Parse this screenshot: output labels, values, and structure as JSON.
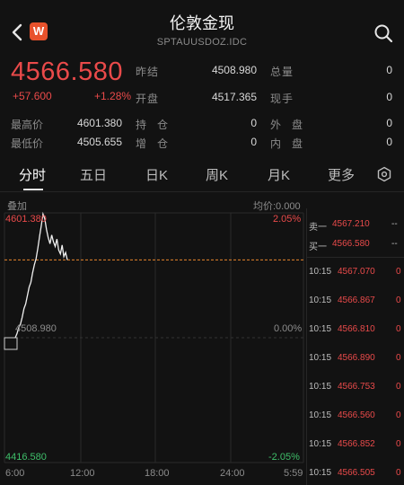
{
  "header": {
    "title": "伦敦金现",
    "subtitle": "SPTAUUSDOZ.IDC",
    "logo_letter": "W"
  },
  "quote": {
    "price": "4566.580",
    "change": "+57.600",
    "change_pct": "+1.28%",
    "prev_close_label": "昨结",
    "prev_close": "4508.980",
    "open_label": "开盘",
    "open": "4517.365",
    "total_volume_label": "总量",
    "total_volume": "0",
    "current_volume_label": "现手",
    "current_volume": "0",
    "high_label": "最高价",
    "high": "4601.380",
    "low_label": "最低价",
    "low": "4505.655",
    "position_label": "持　仓",
    "position": "0",
    "increase_label": "增　仓",
    "increase": "0",
    "outer_label": "外　盘",
    "outer": "0",
    "inner_label": "内　盘",
    "inner": "0"
  },
  "tabs": [
    "分时",
    "五日",
    "日K",
    "周K",
    "月K",
    "更多"
  ],
  "chart_data": {
    "type": "line",
    "overlay_label": "叠加",
    "avg_label": "均价:0.000",
    "y_top": "4601.380",
    "y_mid": "4508.980",
    "y_bottom": "4416.580",
    "pct_top": "2.05%",
    "pct_mid": "0.00%",
    "pct_bottom": "-2.05%",
    "x_ticks": [
      "6:00",
      "12:00",
      "18:00",
      "24:00",
      "5:59"
    ],
    "ylim": [
      4416.58,
      4601.38
    ],
    "prev_close": 4508.98,
    "series": [
      {
        "values": [
          4508.98,
          4512.0,
          4516.5,
          4519.0,
          4524.0,
          4530.5,
          4534.0,
          4540.0,
          4546.5,
          4550.0,
          4557.0,
          4563.0,
          4567.5,
          4575.0,
          4584.0,
          4592.0,
          4600.5,
          4597.0,
          4589.0,
          4583.0,
          4578.5,
          4585.0,
          4580.0,
          4576.5,
          4582.0,
          4574.0,
          4571.0,
          4577.5,
          4569.0,
          4572.0,
          4566.58
        ]
      }
    ],
    "line_color": "#f0f0f0"
  },
  "order_book": [
    {
      "label": "卖一",
      "price": "4567.210",
      "vol": "--"
    },
    {
      "label": "买一",
      "price": "4566.580",
      "vol": "--"
    }
  ],
  "ticks": [
    {
      "time": "10:15",
      "price": "4567.070",
      "vol": "0"
    },
    {
      "time": "10:15",
      "price": "4566.867",
      "vol": "0"
    },
    {
      "time": "10:15",
      "price": "4566.810",
      "vol": "0"
    },
    {
      "time": "10:15",
      "price": "4566.890",
      "vol": "0"
    },
    {
      "time": "10:15",
      "price": "4566.753",
      "vol": "0"
    },
    {
      "time": "10:15",
      "price": "4566.560",
      "vol": "0"
    },
    {
      "time": "10:15",
      "price": "4566.852",
      "vol": "0"
    },
    {
      "time": "10:15",
      "price": "4566.505",
      "vol": "0"
    }
  ],
  "colors": {
    "up": "#e94a4a",
    "accent": "#e8522c",
    "bg": "#121212"
  }
}
